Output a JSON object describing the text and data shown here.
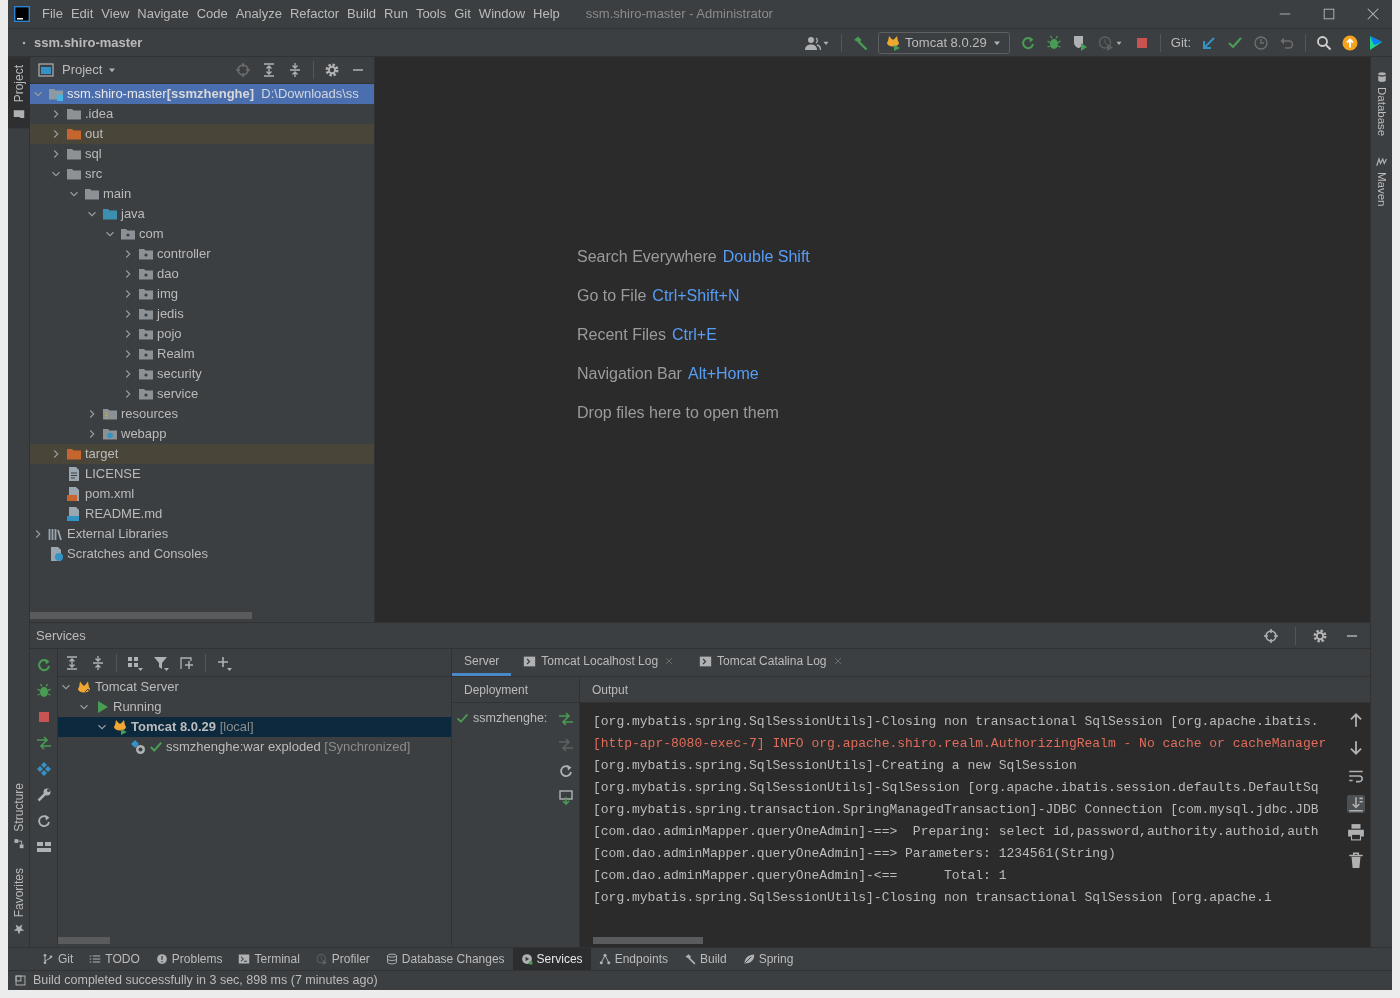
{
  "window": {
    "title": "ssm.shiro-master - Administrator"
  },
  "menu": [
    "File",
    "Edit",
    "View",
    "Navigate",
    "Code",
    "Analyze",
    "Refactor",
    "Build",
    "Run",
    "Tools",
    "Git",
    "Window",
    "Help"
  ],
  "navigation_bar": {
    "breadcrumb": "ssm.shiro-master",
    "run_configuration": "Tomcat 8.0.29",
    "git_label": "Git:"
  },
  "left_stripe": {
    "top": [
      {
        "label": "Project",
        "selected": true
      }
    ],
    "bottom": [
      {
        "label": "Structure",
        "selected": false
      },
      {
        "label": "Favorites",
        "selected": false
      }
    ]
  },
  "right_stripe": [
    {
      "label": "Database",
      "kind": "database"
    },
    {
      "label": "Maven",
      "kind": "maven"
    }
  ],
  "project_panel": {
    "title": "Project",
    "tree": [
      {
        "kind": "module",
        "label": "ssm.shiro-master",
        "module": "[ssmzhenghe]",
        "path": "D:\\Downloads\\ss",
        "expanded": true,
        "selected": true,
        "children": [
          {
            "kind": "folder",
            "label": ".idea",
            "expanded": false,
            "selected": false
          },
          {
            "kind": "excluded",
            "label": "out",
            "expanded": false,
            "selected": false
          },
          {
            "kind": "folder",
            "label": "sql",
            "expanded": false,
            "selected": false
          },
          {
            "kind": "folder",
            "label": "src",
            "expanded": true,
            "selected": false,
            "children": [
              {
                "kind": "folder",
                "label": "main",
                "expanded": true,
                "selected": false,
                "children": [
                  {
                    "kind": "source",
                    "label": "java",
                    "expanded": true,
                    "selected": false,
                    "children": [
                      {
                        "kind": "package",
                        "label": "com",
                        "expanded": true,
                        "selected": false,
                        "children": [
                          {
                            "kind": "package",
                            "label": "controller",
                            "expanded": false,
                            "selected": false
                          },
                          {
                            "kind": "package",
                            "label": "dao",
                            "expanded": false,
                            "selected": false
                          },
                          {
                            "kind": "package",
                            "label": "img",
                            "expanded": false,
                            "selected": false
                          },
                          {
                            "kind": "package",
                            "label": "jedis",
                            "expanded": false,
                            "selected": false
                          },
                          {
                            "kind": "package",
                            "label": "pojo",
                            "expanded": false,
                            "selected": false
                          },
                          {
                            "kind": "package",
                            "label": "Realm",
                            "expanded": false,
                            "selected": false
                          },
                          {
                            "kind": "package",
                            "label": "security",
                            "expanded": false,
                            "selected": false
                          },
                          {
                            "kind": "package",
                            "label": "service",
                            "expanded": false,
                            "selected": false
                          }
                        ]
                      }
                    ]
                  },
                  {
                    "kind": "resources",
                    "label": "resources",
                    "expanded": false,
                    "selected": false
                  },
                  {
                    "kind": "web",
                    "label": "webapp",
                    "expanded": false,
                    "selected": false
                  }
                ]
              }
            ]
          },
          {
            "kind": "excluded",
            "label": "target",
            "expanded": false,
            "selected": false
          },
          {
            "kind": "text",
            "label": "LICENSE",
            "selected": false
          },
          {
            "kind": "maven",
            "label": "pom.xml",
            "selected": false
          },
          {
            "kind": "markdown",
            "label": "README.md",
            "selected": false
          }
        ]
      },
      {
        "kind": "library",
        "label": "External Libraries",
        "expanded": false,
        "selected": false
      },
      {
        "kind": "scratch",
        "label": "Scratches and Consoles",
        "selected": false
      }
    ]
  },
  "editor_hints": [
    {
      "action": "Search Everywhere",
      "shortcut": "Double Shift"
    },
    {
      "action": "Go to File",
      "shortcut": "Ctrl+Shift+N"
    },
    {
      "action": "Recent Files",
      "shortcut": "Ctrl+E"
    },
    {
      "action": "Navigation Bar",
      "shortcut": "Alt+Home"
    },
    {
      "action": "Drop files here to open them"
    }
  ],
  "services": {
    "title": "Services",
    "tree": [
      {
        "kind": "server",
        "label": "Tomcat Server",
        "expanded": true,
        "selected": false,
        "children": [
          {
            "kind": "status",
            "label": "Running",
            "expanded": true,
            "selected": false,
            "children": [
              {
                "kind": "instance",
                "label": "Tomcat 8.0.29",
                "note": "[local]",
                "expanded": true,
                "selected": true,
                "children": [
                  {
                    "kind": "artifact",
                    "label": "ssmzhenghe:war exploded",
                    "note": "[Synchronized]",
                    "selected": false
                  }
                ]
              }
            ]
          }
        ]
      }
    ],
    "tabs": [
      {
        "label": "Server",
        "selected": true,
        "closable": false
      },
      {
        "label": "Tomcat Localhost Log",
        "selected": false,
        "closable": true
      },
      {
        "label": "Tomcat Catalina Log",
        "selected": false,
        "closable": true
      }
    ],
    "deployment": {
      "header": "Deployment",
      "items": [
        {
          "label": "ssmzhenghe:"
        }
      ]
    },
    "output": {
      "header": "Output",
      "lines": [
        {
          "kind": "info",
          "text": "[org.mybatis.spring.SqlSessionUtils]-Closing non transactional SqlSession [org.apache.ibatis."
        },
        {
          "kind": "error",
          "text": "[http-apr-8080-exec-7] INFO org.apache.shiro.realm.AuthorizingRealm - No cache or cacheManager"
        },
        {
          "kind": "info",
          "text": "[org.mybatis.spring.SqlSessionUtils]-Creating a new SqlSession"
        },
        {
          "kind": "info",
          "text": "[org.mybatis.spring.SqlSessionUtils]-SqlSession [org.apache.ibatis.session.defaults.DefaultSq"
        },
        {
          "kind": "info",
          "text": "[org.mybatis.spring.transaction.SpringManagedTransaction]-JDBC Connection [com.mysql.jdbc.JDB"
        },
        {
          "kind": "info",
          "text": "[com.dao.adminMapper.queryOneAdmin]-==>  Preparing: select id,password,authority.authoid,auth"
        },
        {
          "kind": "info",
          "text": "[com.dao.adminMapper.queryOneAdmin]-==> Parameters: 1234561(String)"
        },
        {
          "kind": "info",
          "text": "[com.dao.adminMapper.queryOneAdmin]-<==      Total: 1"
        },
        {
          "kind": "info",
          "text": "[org.mybatis.spring.SqlSessionUtils]-Closing non transactional SqlSession [org.apache.i"
        }
      ]
    }
  },
  "tool_windows": [
    {
      "label": "Git",
      "selected": false
    },
    {
      "label": "TODO",
      "selected": false
    },
    {
      "label": "Problems",
      "selected": false
    },
    {
      "label": "Terminal",
      "selected": false
    },
    {
      "label": "Profiler",
      "selected": false
    },
    {
      "label": "Database Changes",
      "selected": false
    },
    {
      "label": "Services",
      "selected": true
    },
    {
      "label": "Endpoints",
      "selected": false
    },
    {
      "label": "Build",
      "selected": false
    },
    {
      "label": "Spring",
      "selected": false
    }
  ],
  "status_bar": {
    "message": "Build completed successfully in 3 sec, 898 ms (7 minutes ago)"
  }
}
